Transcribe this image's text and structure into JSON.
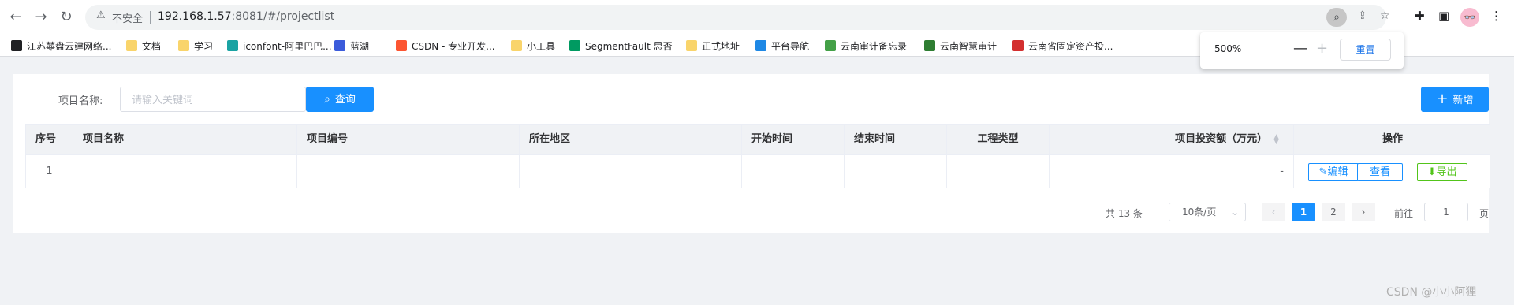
{
  "browser": {
    "insecure_label": "不安全",
    "url_host": "192.168.1.57",
    "url_path": ":8081/#/projectlist",
    "zoom_level": "500%",
    "zoom_reset_label": "重置"
  },
  "bookmarks": [
    {
      "label": "江苏囍盘云建网络...",
      "icon": "dark-globe-icon",
      "color": "#202124"
    },
    {
      "label": "文档",
      "icon": "folder-icon",
      "color": "#f9d46b"
    },
    {
      "label": "学习",
      "icon": "folder-icon",
      "color": "#f9d46b"
    },
    {
      "label": "iconfont-阿里巴巴...",
      "icon": "iconfont-icon",
      "color": "#1aa3a3"
    },
    {
      "label": "蓝湖",
      "icon": "lanhu-icon",
      "color": "#3b5bdb"
    },
    {
      "label": "CSDN - 专业开发...",
      "icon": "csdn-icon",
      "color": "#fc5531"
    },
    {
      "label": "小工具",
      "icon": "folder-icon",
      "color": "#f9d46b"
    },
    {
      "label": "SegmentFault 思否",
      "icon": "sf-icon",
      "color": "#009a61"
    },
    {
      "label": "正式地址",
      "icon": "folder-icon",
      "color": "#f9d46b"
    },
    {
      "label": "平台导航",
      "icon": "platform-icon",
      "color": "#1e88e5"
    },
    {
      "label": "云南审计备忘录",
      "icon": "memo-icon",
      "color": "#43a047"
    },
    {
      "label": "云南智慧审计",
      "icon": "audit-icon",
      "color": "#2e7d32"
    },
    {
      "label": "云南省固定资产投...",
      "icon": "asset-icon",
      "color": "#d32f2f"
    }
  ],
  "filter": {
    "label": "项目名称:",
    "placeholder": "请输入关键词",
    "search_label": "查询",
    "add_label": "新增"
  },
  "table": {
    "headers": [
      "序号",
      "项目名称",
      "项目编号",
      "所在地区",
      "开始时间",
      "结束时间",
      "工程类型",
      "项目投资额（万元）",
      "操作"
    ],
    "rows": [
      {
        "index": "1",
        "name": "",
        "code": "",
        "region": "",
        "start": "",
        "end": "",
        "type": "",
        "investment": "-"
      }
    ],
    "actions": {
      "edit": "编辑",
      "view": "查看",
      "export": "导出"
    }
  },
  "pagination": {
    "total": "共 13 条",
    "page_size": "10条/页",
    "pages": [
      "1",
      "2"
    ],
    "current": "1",
    "goto_label": "前往",
    "goto_value": "1",
    "goto_unit": "页"
  },
  "watermark": "CSDN @小小阿狸"
}
